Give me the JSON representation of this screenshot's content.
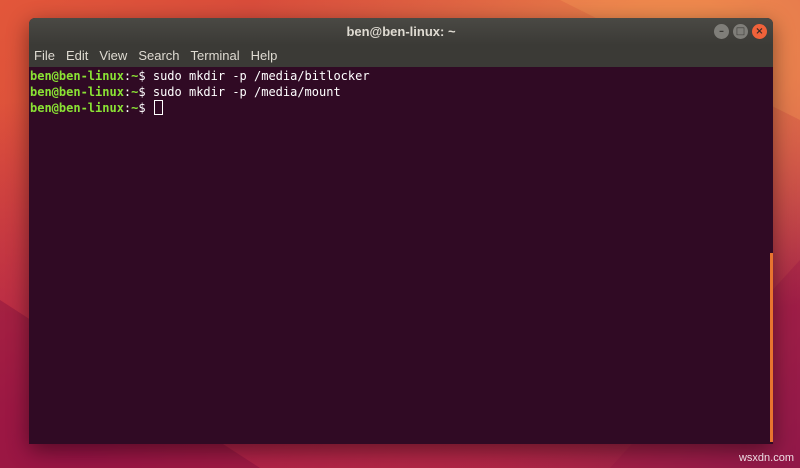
{
  "window": {
    "title": "ben@ben-linux: ~",
    "buttons": [
      "–",
      "□",
      "×"
    ]
  },
  "menubar": {
    "items": [
      "File",
      "Edit",
      "View",
      "Search",
      "Terminal",
      "Help"
    ]
  },
  "terminal": {
    "prompt_user": "ben@ben-linux",
    "prompt_sep": ":",
    "prompt_path": "~",
    "prompt_symbol": "$ ",
    "lines": [
      "sudo mkdir -p /media/bitlocker",
      "sudo mkdir -p /media/mount",
      ""
    ]
  },
  "colors": {
    "prompt": "#8ae234",
    "background": "#300a24",
    "scroll_thumb": "#e8742f",
    "close_button": "#f0623a"
  },
  "watermark": "wsxdn.com"
}
